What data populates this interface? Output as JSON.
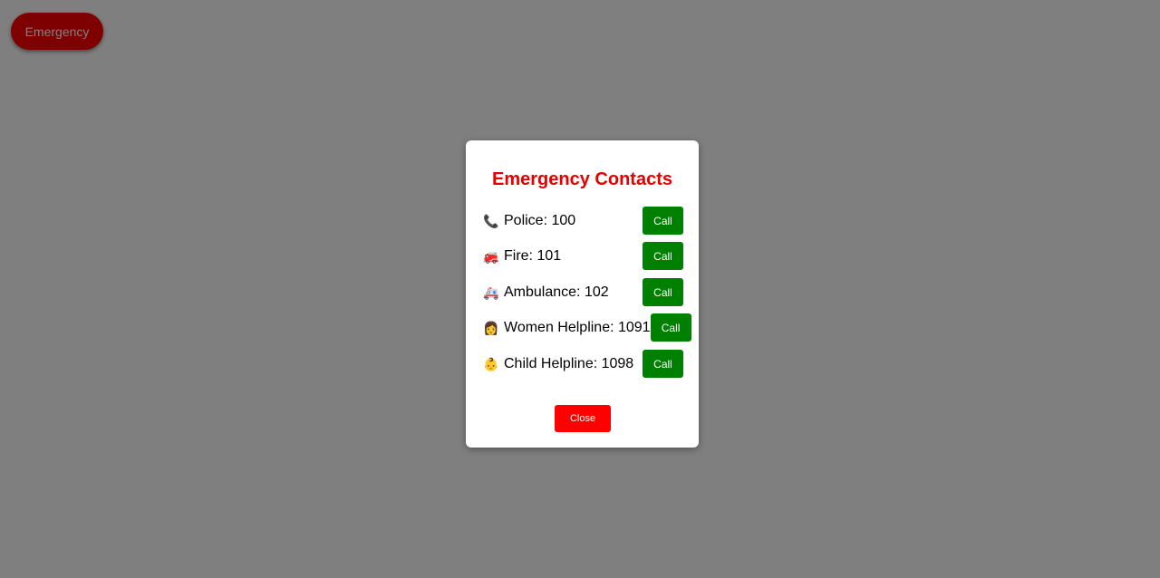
{
  "page": {
    "emergency_button_label": "Emergency"
  },
  "modal": {
    "title": "Emergency Contacts",
    "contacts": [
      {
        "icon": "telephone-receiver-icon",
        "glyph": "📞",
        "label": "Police: 100",
        "button": "Call"
      },
      {
        "icon": "fire-engine-icon",
        "glyph": "🚒",
        "label": "Fire: 101",
        "button": "Call"
      },
      {
        "icon": "ambulance-icon",
        "glyph": "🚑",
        "label": "Ambulance: 102",
        "button": "Call"
      },
      {
        "icon": "woman-icon",
        "glyph": "👩",
        "label": "Women Helpline: 1091",
        "button": "Call"
      },
      {
        "icon": "baby-icon",
        "glyph": "👶",
        "label": "Child Helpline: 1098",
        "button": "Call"
      }
    ],
    "close_label": "Close"
  },
  "colors": {
    "emergency_red": "#ff0000",
    "title_red": "#e60000",
    "call_green": "#008000",
    "overlay": "rgba(0,0,0,0.5)"
  }
}
